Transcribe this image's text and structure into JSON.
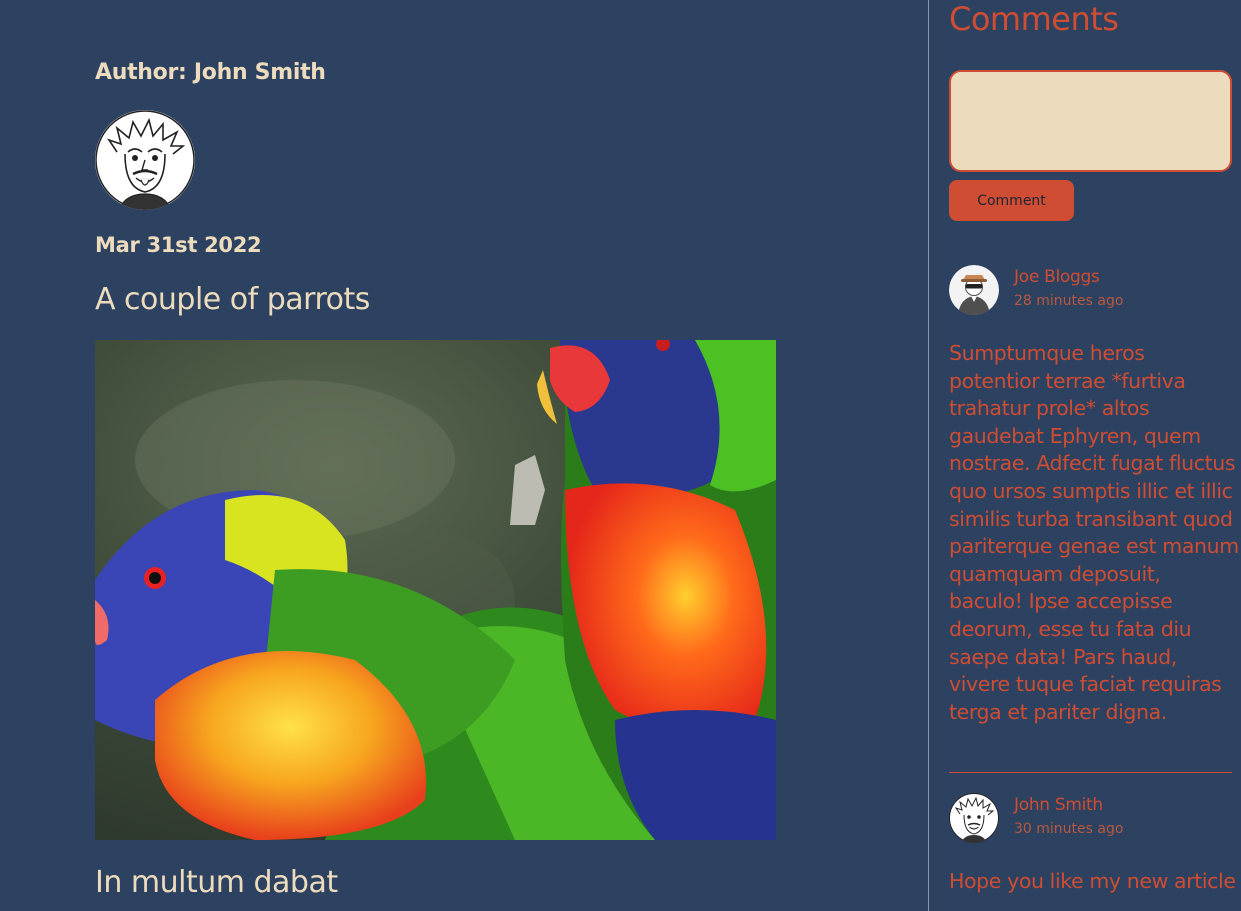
{
  "post": {
    "author_label": "Author: John Smith",
    "date": "Mar 31st 2022",
    "title": "A couple of parrots",
    "section_title": "In multum dabat"
  },
  "sidebar": {
    "title": "Comments",
    "input": {
      "value": "",
      "placeholder": ""
    },
    "button_label": "Comment",
    "comments": [
      {
        "name": "Joe Bloggs",
        "time": "28 minutes ago",
        "avatar_icon": "incognito-user-icon",
        "text": "Sumptumque heros potentior terrae *furtiva trahatur prole* altos gaudebat Ephyren, quem nostrae. Adfecit fugat fluctus quo ursos sumptis illic et illic similis turba transibant quod pariterque genae est manum quamquam deposuit, baculo! Ipse accepisse deorum, esse tu fata diu saepe data! Pars haud, vivere tuque faciat requiras terga et pariter digna."
      },
      {
        "name": "John Smith",
        "time": "30 minutes ago",
        "avatar_icon": "einstein-cartoon-avatar",
        "text": "Hope you like my new article"
      }
    ]
  },
  "colors": {
    "background": "#2d4161",
    "cream": "#ecdcbd",
    "accent": "#cf4d32"
  }
}
